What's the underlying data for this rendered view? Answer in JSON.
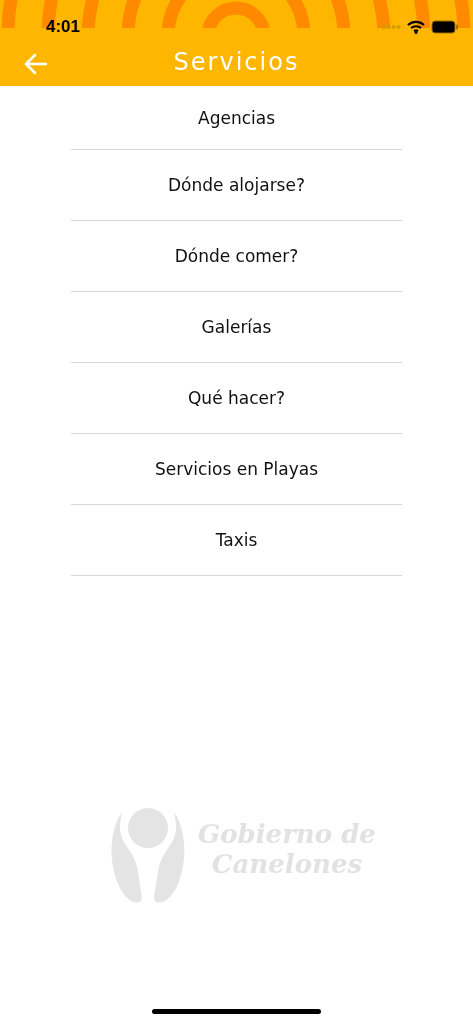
{
  "status_bar": {
    "time": "4:01"
  },
  "header": {
    "title": "Servicios"
  },
  "items": [
    {
      "label": "Agencias"
    },
    {
      "label": "Dónde alojarse?"
    },
    {
      "label": "Dónde comer?"
    },
    {
      "label": "Galerías"
    },
    {
      "label": "Qué hacer?"
    },
    {
      "label": "Servicios en Playas"
    },
    {
      "label": "Taxis"
    }
  ],
  "logo": {
    "lines": [
      "Gobierno de",
      "Canelones"
    ]
  }
}
